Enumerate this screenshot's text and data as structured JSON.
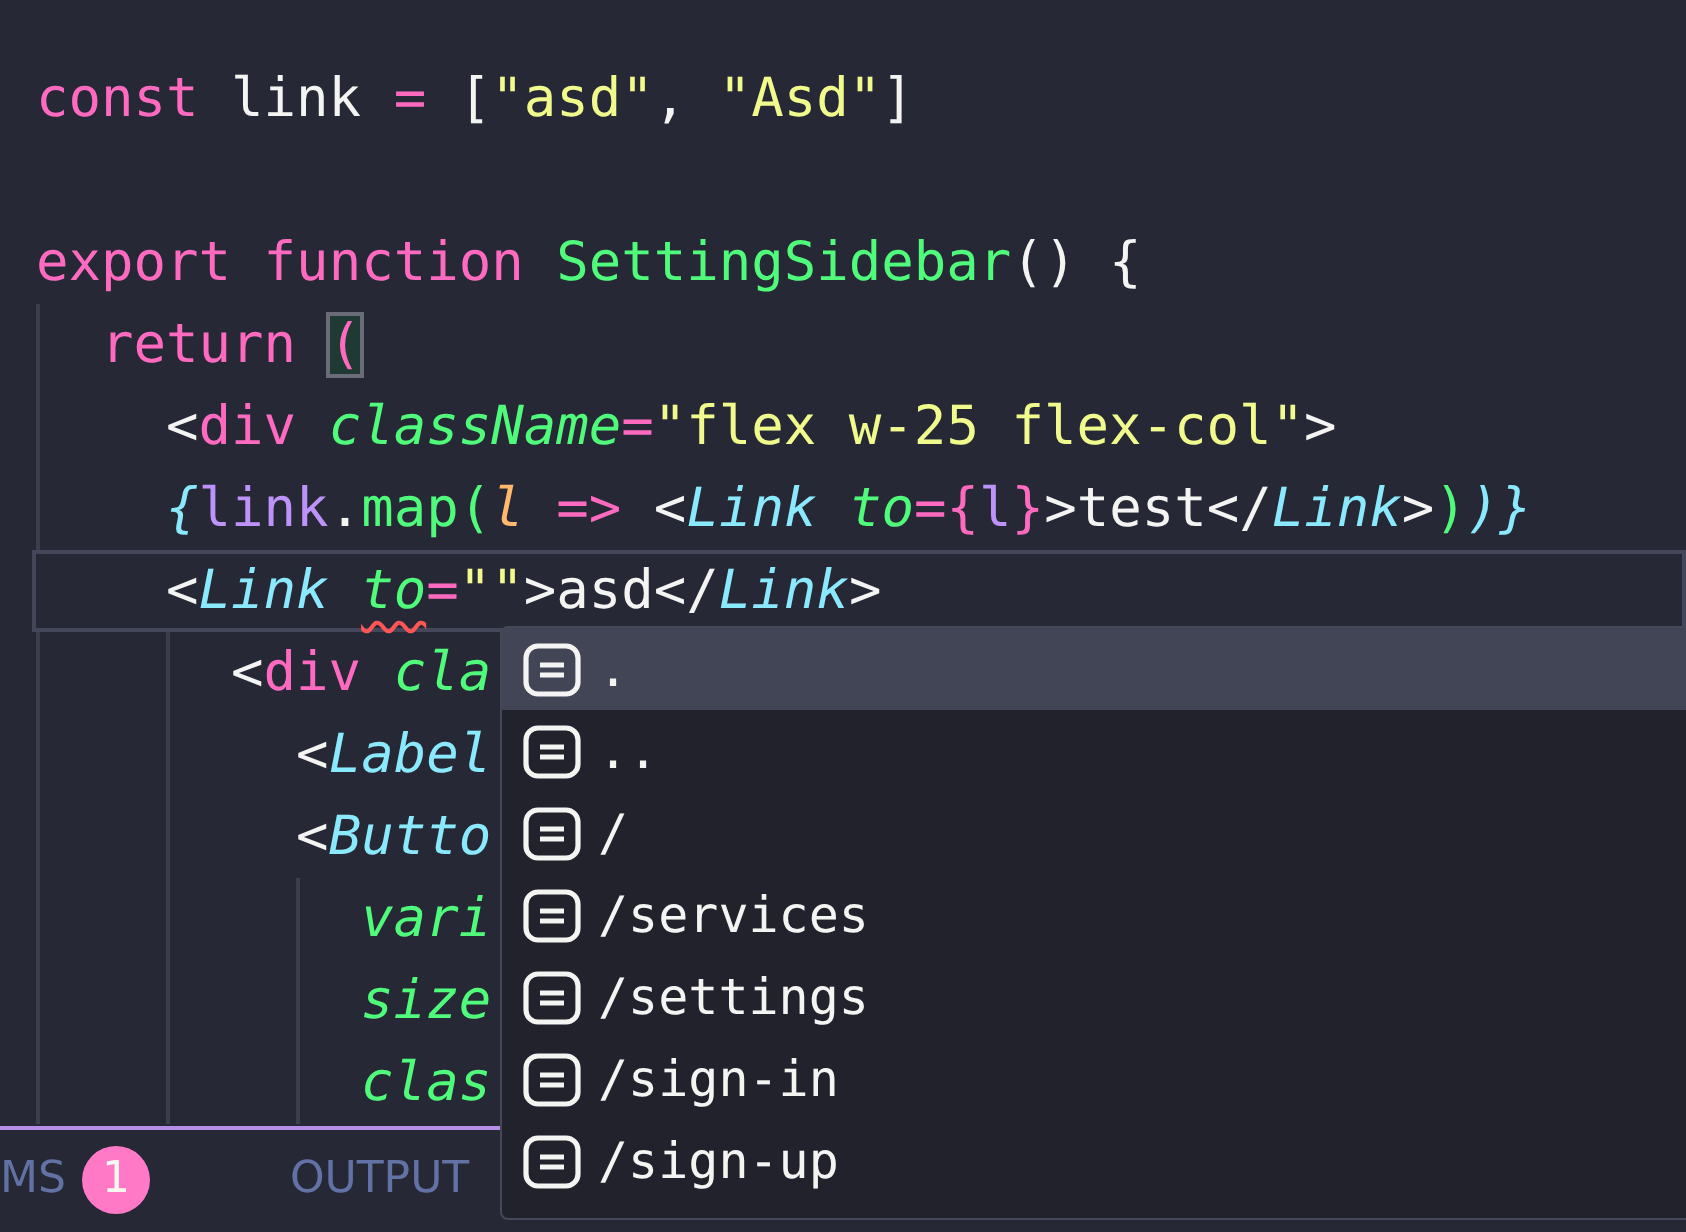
{
  "editor": {
    "lines": [
      {
        "current": false,
        "tokens": [
          {
            "text": "const",
            "kind": "keyword"
          },
          {
            "text": " link",
            "kind": "plain"
          },
          {
            "text": " =",
            "kind": "keyword"
          },
          {
            "text": " [",
            "kind": "plain"
          },
          {
            "text": "\"asd\"",
            "kind": "string"
          },
          {
            "text": ", ",
            "kind": "plain"
          },
          {
            "text": "\"Asd\"",
            "kind": "string"
          },
          {
            "text": "]",
            "kind": "plain"
          }
        ]
      },
      {
        "current": false
      },
      {
        "current": false,
        "tokens": [
          {
            "text": "export",
            "kind": "keyword"
          },
          {
            "text": " function",
            "kind": "keyword"
          },
          {
            "text": " SettingSidebar",
            "kind": "function"
          },
          {
            "text": "() {",
            "kind": "plain"
          }
        ]
      },
      {
        "current": false,
        "tokens": [
          {
            "text": "  return ",
            "kind": "keyword"
          },
          {
            "text": "(",
            "kind": "keyword",
            "bracket_match": true
          }
        ]
      },
      {
        "current": false,
        "tokens": [
          {
            "text": "    <",
            "kind": "plain"
          },
          {
            "text": "div",
            "kind": "tag"
          },
          {
            "text": " className",
            "kind": "attr"
          },
          {
            "text": "=",
            "kind": "keyword"
          },
          {
            "text": "\"flex w-25 flex-col\"",
            "kind": "string"
          },
          {
            "text": ">",
            "kind": "plain"
          }
        ]
      },
      {
        "current": false,
        "tokens": [
          {
            "text": "    {",
            "kind": "component"
          },
          {
            "text": "link",
            "kind": "variable"
          },
          {
            "text": ".",
            "kind": "plain"
          },
          {
            "text": "map",
            "kind": "function"
          },
          {
            "text": "(",
            "kind": "function"
          },
          {
            "text": "l",
            "kind": "param"
          },
          {
            "text": " =>",
            "kind": "keyword"
          },
          {
            "text": " <",
            "kind": "plain"
          },
          {
            "text": "Link",
            "kind": "component"
          },
          {
            "text": " to",
            "kind": "attr"
          },
          {
            "text": "=",
            "kind": "keyword"
          },
          {
            "text": "{",
            "kind": "keyword"
          },
          {
            "text": "l",
            "kind": "variable"
          },
          {
            "text": "}",
            "kind": "keyword"
          },
          {
            "text": ">test</",
            "kind": "plain"
          },
          {
            "text": "Link",
            "kind": "component"
          },
          {
            "text": ">",
            "kind": "plain"
          },
          {
            "text": ")",
            "kind": "function"
          },
          {
            "text": ")}",
            "kind": "component"
          }
        ]
      },
      {
        "current": true,
        "tokens": [
          {
            "text": "    <",
            "kind": "plain"
          },
          {
            "text": "Link ",
            "kind": "component"
          },
          {
            "text": "to",
            "kind": "attr",
            "error": true
          },
          {
            "text": "=",
            "kind": "keyword"
          },
          {
            "text": "\"\"",
            "kind": "string"
          },
          {
            "text": ">asd</",
            "kind": "plain"
          },
          {
            "text": "Link",
            "kind": "component"
          },
          {
            "text": ">",
            "kind": "plain"
          }
        ]
      },
      {
        "current": false,
        "tokens": [
          {
            "text": "      <",
            "kind": "plain"
          },
          {
            "text": "div",
            "kind": "tag"
          },
          {
            "text": " cla",
            "kind": "attr"
          }
        ]
      },
      {
        "current": false,
        "tokens": [
          {
            "text": "        <",
            "kind": "plain"
          },
          {
            "text": "Label",
            "kind": "component"
          }
        ]
      },
      {
        "current": false,
        "tokens": [
          {
            "text": "        <",
            "kind": "plain"
          },
          {
            "text": "Butto",
            "kind": "component"
          }
        ]
      },
      {
        "current": false,
        "tokens": [
          {
            "text": "          vari",
            "kind": "attr"
          }
        ]
      },
      {
        "current": false,
        "tokens": [
          {
            "text": "          size",
            "kind": "attr"
          }
        ]
      },
      {
        "current": false,
        "tokens": [
          {
            "text": "          clas",
            "kind": "attr"
          }
        ]
      }
    ]
  },
  "panel_tabs": [
    {
      "label": "MS",
      "badge": "1"
    },
    {
      "label": "OUTPUT"
    }
  ],
  "suggestions": [
    {
      "label": ".",
      "selected": true
    },
    {
      "label": "..",
      "selected": false
    },
    {
      "label": "/",
      "selected": false
    },
    {
      "label": "/services",
      "selected": false
    },
    {
      "label": "/settings",
      "selected": false
    },
    {
      "label": "/sign-in",
      "selected": false
    },
    {
      "label": "/sign-up",
      "selected": false
    }
  ]
}
